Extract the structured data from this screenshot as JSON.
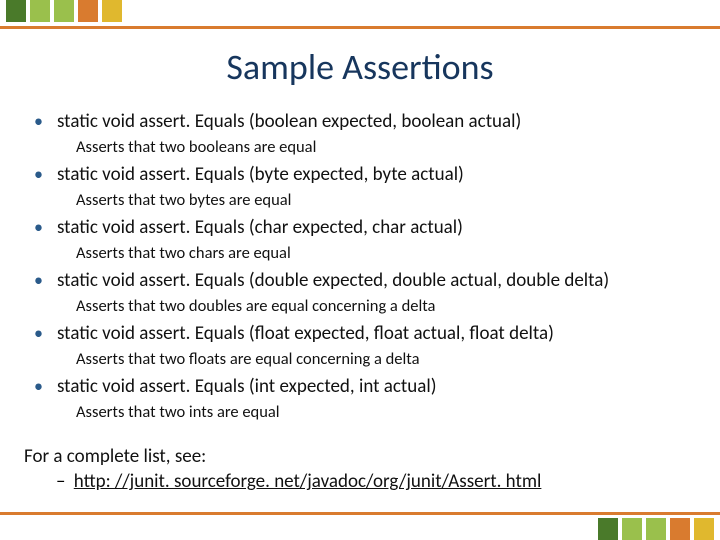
{
  "title": "Sample Assertions",
  "items": [
    {
      "sig": "static void assert. Equals (boolean expected, boolean actual)",
      "desc": "Asserts that two booleans are equal"
    },
    {
      "sig": "static void assert. Equals (byte expected, byte actual)",
      "desc": "Asserts that two bytes are equal"
    },
    {
      "sig": "static void assert. Equals (char expected, char actual)",
      "desc": "Asserts that two chars are equal"
    },
    {
      "sig": "static void assert. Equals (double expected, double actual, double delta)",
      "desc": "Asserts that two doubles are equal concerning a delta"
    },
    {
      "sig": "static void assert. Equals (float expected, float actual, float delta)",
      "desc": "Asserts that two floats are equal concerning a delta"
    },
    {
      "sig": "static void assert. Equals (int expected, int actual)",
      "desc": "Asserts that two ints are equal"
    }
  ],
  "footer_lead": "For a complete list, see:",
  "footer_link": "http: //junit. sourceforge. net/javadoc/org/junit/Assert. html",
  "colors": {
    "dark_green": "#4a7a2a",
    "light_green": "#9ac04c",
    "orange": "#d97b2f",
    "yellow": "#e0b82e"
  }
}
